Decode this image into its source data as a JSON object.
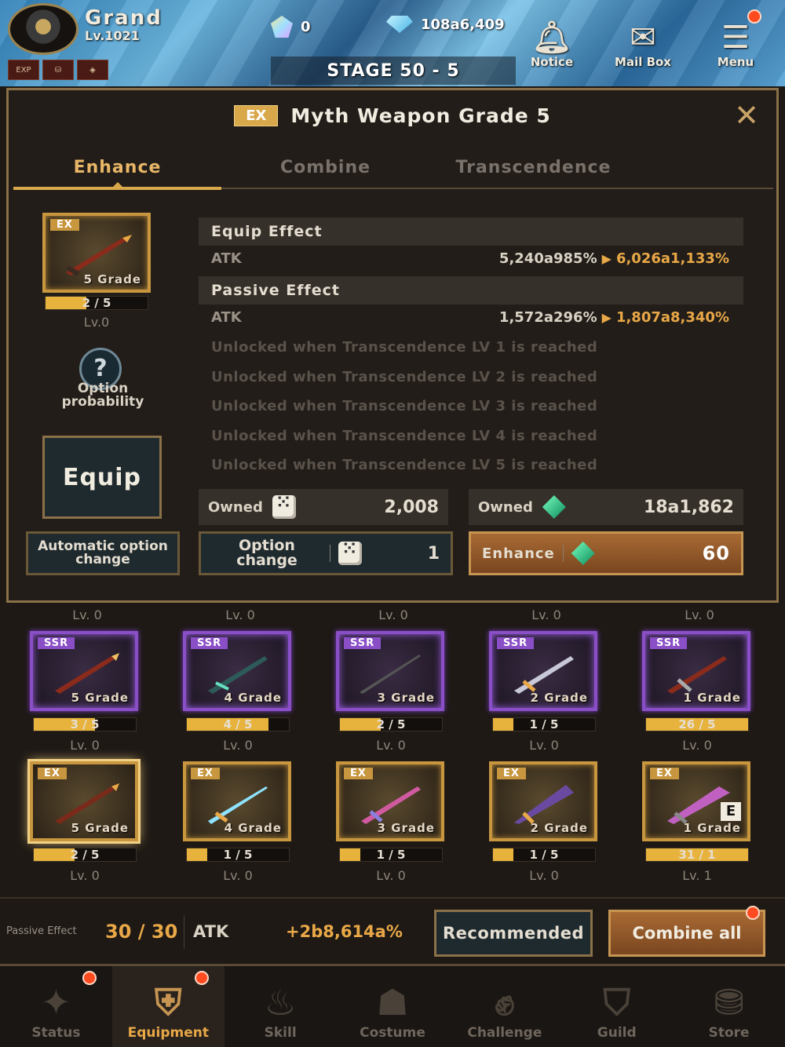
{
  "player": {
    "name": "Grand",
    "level": "Lv.1021",
    "mini_icons": [
      "EXP",
      "",
      ""
    ]
  },
  "currencies": {
    "gems": "0",
    "diamonds": "108a6,409"
  },
  "stage": "STAGE 50 - 5",
  "top_buttons": {
    "notice": "Notice",
    "mailbox": "Mail Box",
    "menu": "Menu"
  },
  "modal": {
    "ex_tag": "EX",
    "title": "Myth Weapon Grade 5",
    "tabs": [
      "Enhance",
      "Combine",
      "Transcendence"
    ],
    "item": {
      "rarity": "EX",
      "grade": "5 Grade",
      "count": "2 / 5",
      "count_fraction": 0.4,
      "level": "Lv.0"
    },
    "option_probability": "Option probability",
    "equip_label": "Equip",
    "equip_effect": {
      "title": "Equip Effect",
      "stat": "ATK",
      "old": "5,240a985%",
      "new": "6,026a1,133%"
    },
    "passive_effect": {
      "title": "Passive Effect",
      "stat": "ATK",
      "old": "1,572a296%",
      "new": "1,807a8,340%"
    },
    "locked_lines": [
      "Unlocked when Transcendence LV 1 is reached",
      "Unlocked when Transcendence LV 2 is reached",
      "Unlocked when Transcendence LV 3 is reached",
      "Unlocked when Transcendence LV 4 is reached",
      "Unlocked when Transcendence LV 5 is reached"
    ],
    "owned_dice": {
      "label": "Owned",
      "value": "2,008"
    },
    "owned_emerald": {
      "label": "Owned",
      "value": "18a1,862"
    },
    "auto_option": "Automatic option change",
    "option_change": {
      "label": "Option change",
      "cost": "1"
    },
    "enhance": {
      "label": "Enhance",
      "cost": "60"
    }
  },
  "grid": {
    "top_lv": [
      "Lv. 0",
      "Lv. 0",
      "Lv. 0",
      "Lv. 0",
      "Lv. 0"
    ],
    "ssr_row": [
      {
        "rarity": "SSR",
        "grade": "5 Grade",
        "count": "3 / 5",
        "fill": 0.6,
        "lv": "Lv. 0"
      },
      {
        "rarity": "SSR",
        "grade": "4 Grade",
        "count": "4 / 5",
        "fill": 0.8,
        "lv": "Lv. 0"
      },
      {
        "rarity": "SSR",
        "grade": "3 Grade",
        "count": "2 / 5",
        "fill": 0.4,
        "lv": "Lv. 0"
      },
      {
        "rarity": "SSR",
        "grade": "2 Grade",
        "count": "1 / 5",
        "fill": 0.2,
        "lv": "Lv. 0"
      },
      {
        "rarity": "SSR",
        "grade": "1 Grade",
        "count": "26 / 5",
        "fill": 1.0,
        "lv": "Lv. 0"
      }
    ],
    "ex_row": [
      {
        "rarity": "EX",
        "grade": "5 Grade",
        "count": "2 / 5",
        "fill": 0.4,
        "lv": "Lv. 0"
      },
      {
        "rarity": "EX",
        "grade": "4 Grade",
        "count": "1 / 5",
        "fill": 0.2,
        "lv": "Lv. 0"
      },
      {
        "rarity": "EX",
        "grade": "3 Grade",
        "count": "1 / 5",
        "fill": 0.2,
        "lv": "Lv. 0"
      },
      {
        "rarity": "EX",
        "grade": "2 Grade",
        "count": "1 / 5",
        "fill": 0.2,
        "lv": "Lv. 0"
      },
      {
        "rarity": "EX",
        "grade": "1 Grade",
        "count": "31 / 1",
        "fill": 1.0,
        "lv": "Lv. 1",
        "mark": "E"
      }
    ]
  },
  "summary": {
    "label": "Passive Effect",
    "count": "30 / 30",
    "stat": "ATK",
    "bonus": "+2b8,614a%",
    "recommended": "Recommended",
    "combine_all": "Combine all"
  },
  "nav": [
    "Status",
    "Equipment",
    "Skill",
    "Costume",
    "Challenge",
    "Guild",
    "Store"
  ],
  "colors": {
    "accent": "#e9a847",
    "ex_border": "#c7963e",
    "ssr_border": "#8a4fc7",
    "enhance_btn": "#a86a33"
  }
}
